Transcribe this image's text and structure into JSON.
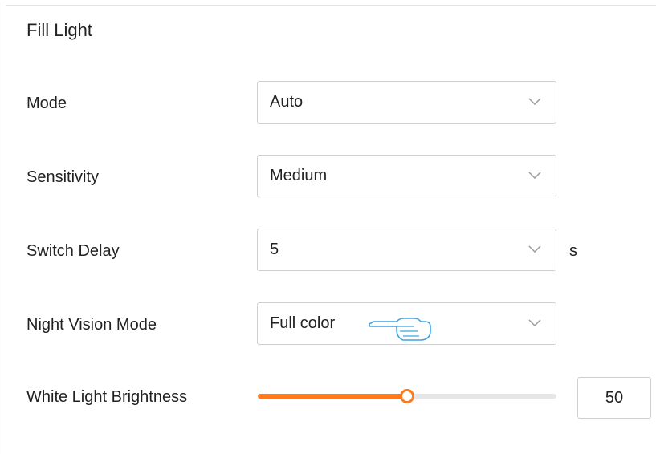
{
  "section": {
    "title": "Fill Light"
  },
  "mode": {
    "label": "Mode",
    "value": "Auto"
  },
  "sensitivity": {
    "label": "Sensitivity",
    "value": "Medium"
  },
  "switch_delay": {
    "label": "Switch Delay",
    "value": "5",
    "unit": "s"
  },
  "night_vision_mode": {
    "label": "Night Vision Mode",
    "value": "Full color"
  },
  "white_light_brightness": {
    "label": "White Light Brightness",
    "value": "50",
    "level_fraction": 0.5
  },
  "icons": {
    "dropdown": "chevron-down-icon",
    "pointer": "pointing-hand-cursor-icon"
  },
  "colors": {
    "accent": "#ff7a1a",
    "hand_outline": "#3aa3e0",
    "border": "#cfcfcf"
  }
}
